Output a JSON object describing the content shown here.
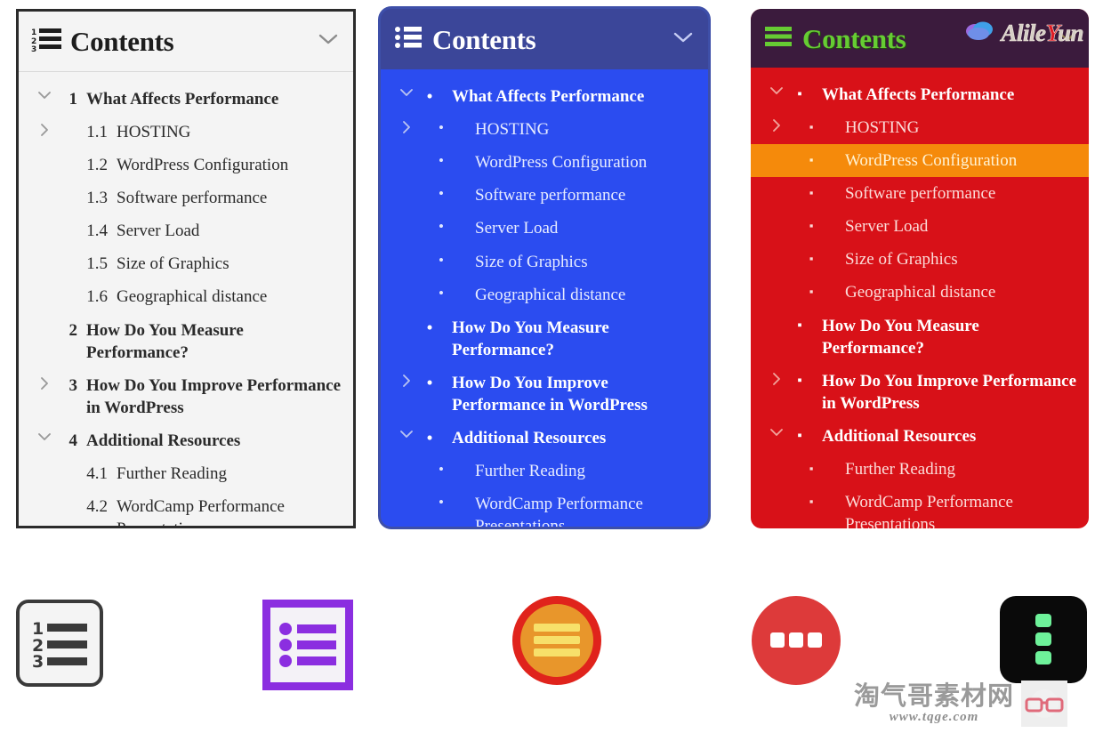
{
  "panels": [
    {
      "id": "classic",
      "style_name": "classic-light",
      "header": {
        "title": "Contents",
        "icon": "numbered-list-icon",
        "toggle_icon": "chevron-down-icon"
      },
      "items": [
        {
          "level": 1,
          "marker": "1",
          "label": "What Affects Performance",
          "twisty": "chevron-down"
        },
        {
          "level": 2,
          "marker": "1.1",
          "label": "HOSTING",
          "twisty": "chevron-right"
        },
        {
          "level": 2,
          "marker": "1.2",
          "label": "WordPress Configuration",
          "twisty": "none"
        },
        {
          "level": 2,
          "marker": "1.3",
          "label": "Software performance",
          "twisty": "none"
        },
        {
          "level": 2,
          "marker": "1.4",
          "label": "Server Load",
          "twisty": "none"
        },
        {
          "level": 2,
          "marker": "1.5",
          "label": "Size of Graphics",
          "twisty": "none"
        },
        {
          "level": 2,
          "marker": "1.6",
          "label": "Geographical distance",
          "twisty": "none"
        },
        {
          "level": 1,
          "marker": "2",
          "label": "How Do You Measure Performance?",
          "twisty": "none"
        },
        {
          "level": 1,
          "marker": "3",
          "label": "How Do You Improve Performance in WordPress",
          "twisty": "chevron-right"
        },
        {
          "level": 1,
          "marker": "4",
          "label": "Additional Resources",
          "twisty": "chevron-down"
        },
        {
          "level": 2,
          "marker": "4.1",
          "label": "Further Reading",
          "twisty": "none"
        },
        {
          "level": 2,
          "marker": "4.2",
          "label": "WordCamp Performance Presentations",
          "twisty": "none"
        }
      ]
    },
    {
      "id": "blue",
      "style_name": "blue-bullets",
      "header": {
        "title": "Contents",
        "icon": "bulleted-list-icon",
        "toggle_icon": "chevron-down-icon"
      },
      "items": [
        {
          "level": 1,
          "marker": "•",
          "label": "What Affects Performance",
          "twisty": "chevron-down"
        },
        {
          "level": 2,
          "marker": "•",
          "label": "HOSTING",
          "twisty": "chevron-right"
        },
        {
          "level": 2,
          "marker": "•",
          "label": "WordPress Configuration",
          "twisty": "none"
        },
        {
          "level": 2,
          "marker": "•",
          "label": "Software performance",
          "twisty": "none"
        },
        {
          "level": 2,
          "marker": "•",
          "label": "Server Load",
          "twisty": "none"
        },
        {
          "level": 2,
          "marker": "•",
          "label": "Size of Graphics",
          "twisty": "none"
        },
        {
          "level": 2,
          "marker": "•",
          "label": "Geographical distance",
          "twisty": "none"
        },
        {
          "level": 1,
          "marker": "•",
          "label": "How Do You Measure Performance?",
          "twisty": "none"
        },
        {
          "level": 1,
          "marker": "•",
          "label": "How Do You Improve Performance in WordPress",
          "twisty": "chevron-right"
        },
        {
          "level": 1,
          "marker": "•",
          "label": "Additional Resources",
          "twisty": "chevron-down"
        },
        {
          "level": 2,
          "marker": "•",
          "label": "Further Reading",
          "twisty": "none"
        },
        {
          "level": 2,
          "marker": "•",
          "label": "WordCamp Performance Presentations",
          "twisty": "none"
        }
      ]
    },
    {
      "id": "red",
      "style_name": "red-squares",
      "header": {
        "title": "Contents",
        "icon": "hamburger-list-icon",
        "toggle_icon": "chevron-down-icon"
      },
      "watermark": {
        "text_a": "Alile",
        "text_y": "Y",
        "text_b": "un",
        "icon": "cloud-icon"
      },
      "items": [
        {
          "level": 1,
          "marker": "▪",
          "label": "What Affects Performance",
          "twisty": "chevron-down",
          "active": false
        },
        {
          "level": 2,
          "marker": "▪",
          "label": "HOSTING",
          "twisty": "chevron-right",
          "active": false
        },
        {
          "level": 2,
          "marker": "▪",
          "label": "WordPress Configuration",
          "twisty": "none",
          "active": true
        },
        {
          "level": 2,
          "marker": "▪",
          "label": "Software performance",
          "twisty": "none",
          "active": false
        },
        {
          "level": 2,
          "marker": "▪",
          "label": "Server Load",
          "twisty": "none",
          "active": false
        },
        {
          "level": 2,
          "marker": "▪",
          "label": "Size of Graphics",
          "twisty": "none",
          "active": false
        },
        {
          "level": 2,
          "marker": "▪",
          "label": "Geographical distance",
          "twisty": "none",
          "active": false
        },
        {
          "level": 1,
          "marker": "▪",
          "label": "How Do You Measure Performance?",
          "twisty": "none",
          "active": false
        },
        {
          "level": 1,
          "marker": "▪",
          "label": "How Do You Improve Performance in WordPress",
          "twisty": "chevron-right",
          "active": false
        },
        {
          "level": 1,
          "marker": "▪",
          "label": "Additional Resources",
          "twisty": "chevron-down",
          "active": false
        },
        {
          "level": 2,
          "marker": "▪",
          "label": "Further Reading",
          "twisty": "none",
          "active": false
        },
        {
          "level": 2,
          "marker": "▪",
          "label": "WordCamp Performance Presentations",
          "twisty": "none",
          "active": false
        }
      ]
    }
  ],
  "icons": [
    {
      "name": "numbered-list-boxed-icon",
      "fg": "#3a3a3a",
      "bg": "#f4f4f4"
    },
    {
      "name": "bulleted-list-framed-icon",
      "fg": "#8b2ee0",
      "bg": "#f4f2f7"
    },
    {
      "name": "hamburger-circle-icon",
      "fg": "#f7e06a",
      "bg": "#e8962b",
      "ring": "#e0231c"
    },
    {
      "name": "ellipsis-circle-icon",
      "fg": "#ffffff",
      "bg": "#dd3a3a"
    },
    {
      "name": "kebab-menu-icon",
      "fg": "#6ef29a",
      "bg": "#0a0a0a"
    }
  ],
  "site_watermark": {
    "name_cn": "淘气哥素材网",
    "url": "www.tqge.com",
    "logo": "glasses-icon"
  },
  "colors": {
    "classic_bg": "#f4f4f4",
    "classic_border": "#2b2b2b",
    "classic_text": "#2a2a2a",
    "blue_body": "#2b4cf0",
    "blue_header": "#3b4699",
    "red_body": "#d81118",
    "red_header": "#3b1b3d",
    "red_header_title": "#66cc33",
    "red_active": "#f58a0b"
  }
}
